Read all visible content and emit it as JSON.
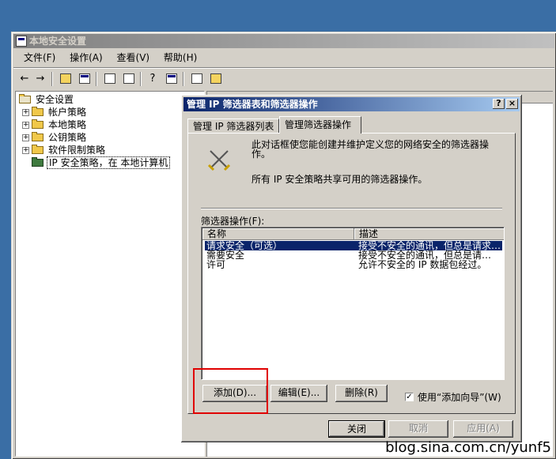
{
  "main_window": {
    "title": "本地安全设置",
    "menu": [
      "文件(F)",
      "操作(A)",
      "查看(V)",
      "帮助(H)"
    ],
    "toolbar_icons": [
      "back-arrow",
      "forward-arrow",
      "up-folder",
      "show-hide-tree",
      "properties",
      "refresh",
      "export-list",
      "help",
      "action-pane",
      "new-item",
      "add-remove"
    ]
  },
  "tree": {
    "root": "安全设置",
    "items": [
      "帐户策略",
      "本地策略",
      "公钥策略",
      "软件限制策略",
      "IP 安全策略，在 本地计算机"
    ]
  },
  "dialog": {
    "title": "管理 IP 筛选器表和筛选器操作",
    "help_glyph": "?",
    "close_glyph": "×",
    "tabs": [
      "管理 IP 筛选器列表",
      "管理筛选器操作"
    ],
    "intro_line1": "此对话框使您能创建并维护定义您的网络安全的筛选器操作。",
    "intro_line2": "所有 IP 安全策略共享可用的筛选器操作。",
    "list_label": "筛选器操作(F):",
    "columns": [
      "名称",
      "描述"
    ],
    "rows": [
      {
        "name": "请求安全（可选）",
        "desc": "接受不安全的通讯，但总是请求…"
      },
      {
        "name": "需要安全",
        "desc": "接受不安全的通讯，但总是请…"
      },
      {
        "name": "许可",
        "desc": "允许不安全的 IP 数据包经过。"
      }
    ],
    "buttons": {
      "add": "添加(D)...",
      "edit": "编辑(E)...",
      "remove": "删除(R)"
    },
    "wizard_checkbox": {
      "label": "使用“添加向导”(W)",
      "checked": true,
      "mark": "✓"
    },
    "footer": {
      "close": "关闭",
      "cancel": "取消",
      "apply": "应用(A)"
    }
  },
  "watermark": "blog.sina.com.cn/yunf5",
  "colors": {
    "desktop": "#3a6ea5",
    "face": "#d4d0c8",
    "active_title": "#0a246a",
    "highlight_box": "#e00000"
  }
}
